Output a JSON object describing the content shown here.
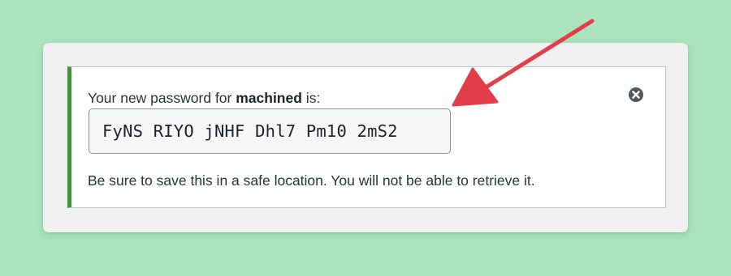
{
  "notice": {
    "intro_prefix": "Your new password for ",
    "username": "machined",
    "intro_suffix": " is:",
    "password": "FyNS RIYO jNHF Dhl7 Pm10 2mS2",
    "warning": "Be sure to save this in a safe location. You will not be able to retrieve it.",
    "dismiss_icon": "close-circle-icon"
  },
  "colors": {
    "background": "#abe3bc",
    "success_border": "#3b9b38",
    "arrow": "#e23d48"
  }
}
